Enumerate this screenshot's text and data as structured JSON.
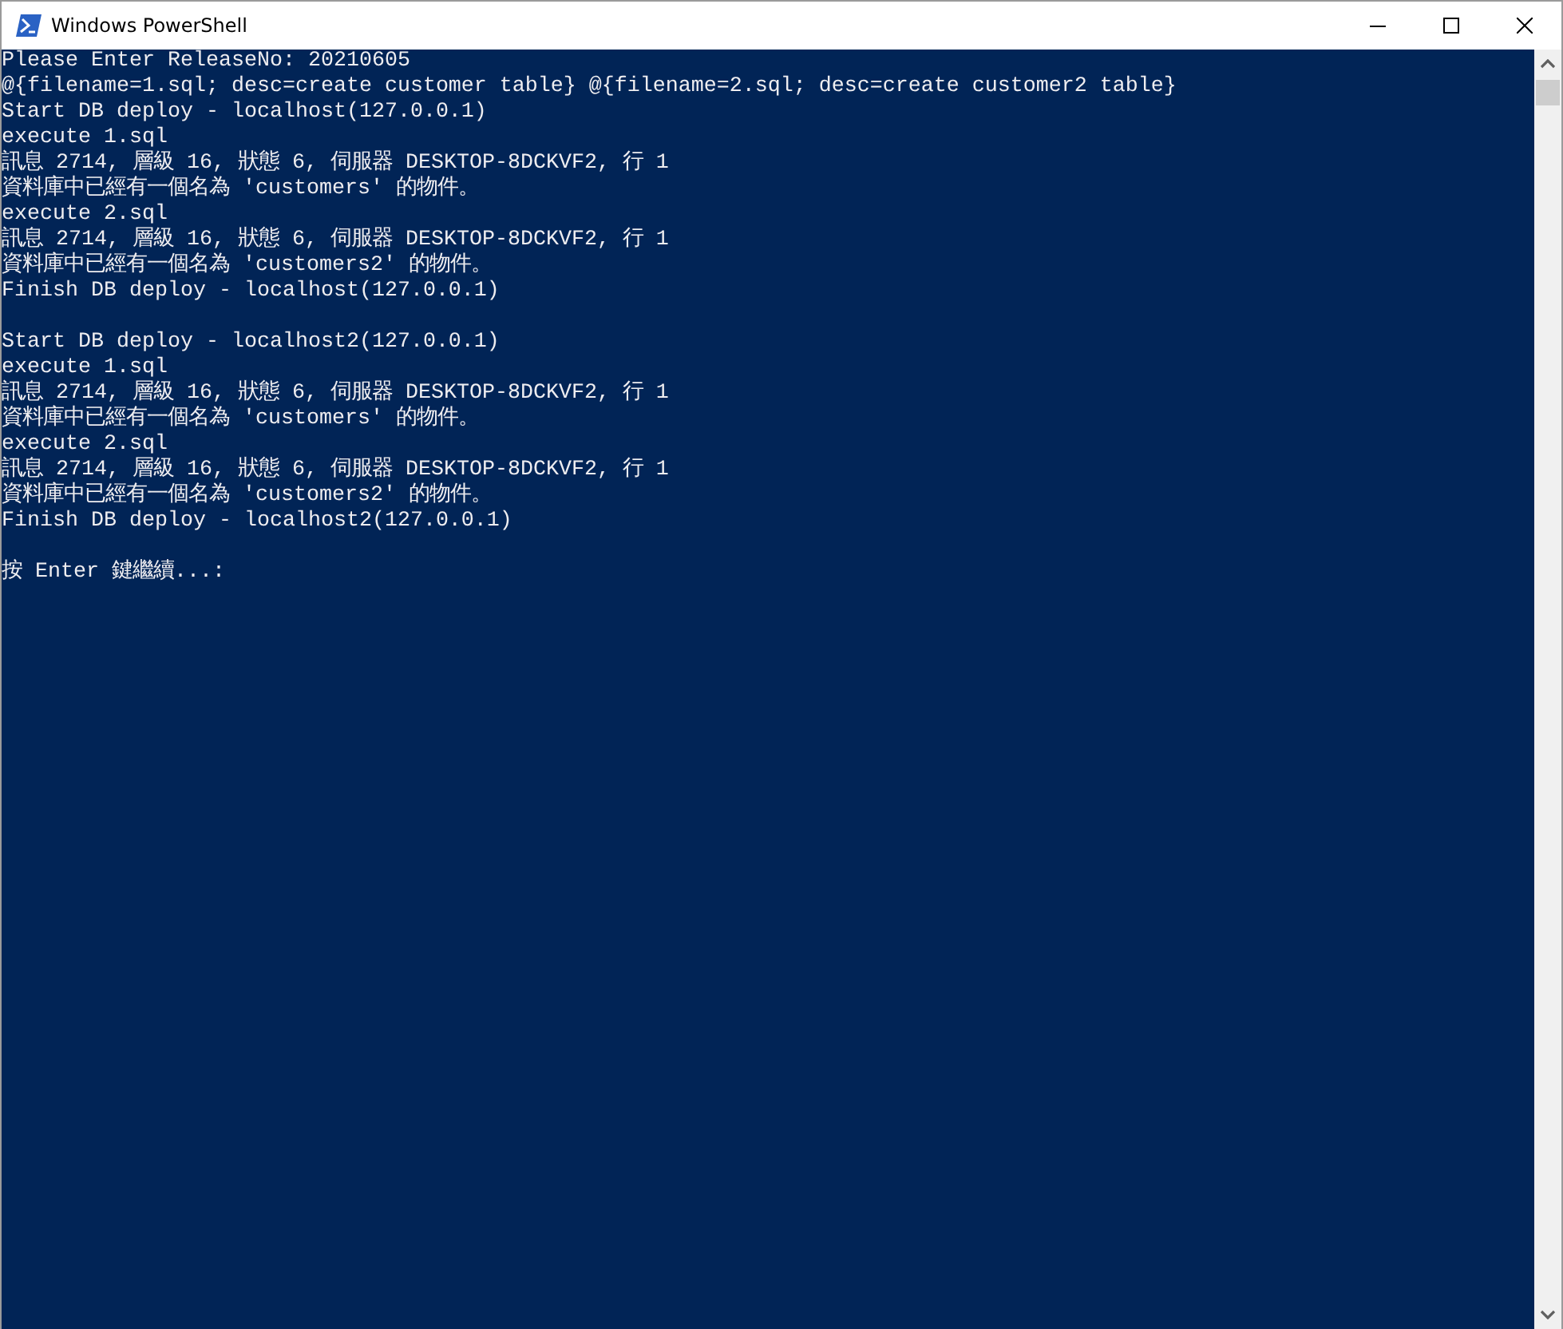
{
  "window": {
    "title": "Windows PowerShell"
  },
  "console": {
    "blocks": [
      [
        "Please Enter ReleaseNo: 20210605",
        "@{filename=1.sql; desc=create customer table} @{filename=2.sql; desc=create customer2 table}",
        "Start DB deploy - localhost(127.0.0.1)",
        "execute 1.sql",
        "訊息 2714, 層級 16, 狀態 6, 伺服器 DESKTOP-8DCKVF2, 行 1",
        "資料庫中已經有一個名為 'customers' 的物件。",
        "execute 2.sql",
        "訊息 2714, 層級 16, 狀態 6, 伺服器 DESKTOP-8DCKVF2, 行 1",
        "資料庫中已經有一個名為 'customers2' 的物件。",
        "Finish DB deploy - localhost(127.0.0.1)"
      ],
      [
        "Start DB deploy - localhost2(127.0.0.1)",
        "execute 1.sql",
        "訊息 2714, 層級 16, 狀態 6, 伺服器 DESKTOP-8DCKVF2, 行 1",
        "資料庫中已經有一個名為 'customers' 的物件。",
        "execute 2.sql",
        "訊息 2714, 層級 16, 狀態 6, 伺服器 DESKTOP-8DCKVF2, 行 1",
        "資料庫中已經有一個名為 'customers2' 的物件。",
        "Finish DB deploy - localhost2(127.0.0.1)"
      ],
      [
        "按 Enter 鍵繼續...:"
      ]
    ]
  }
}
